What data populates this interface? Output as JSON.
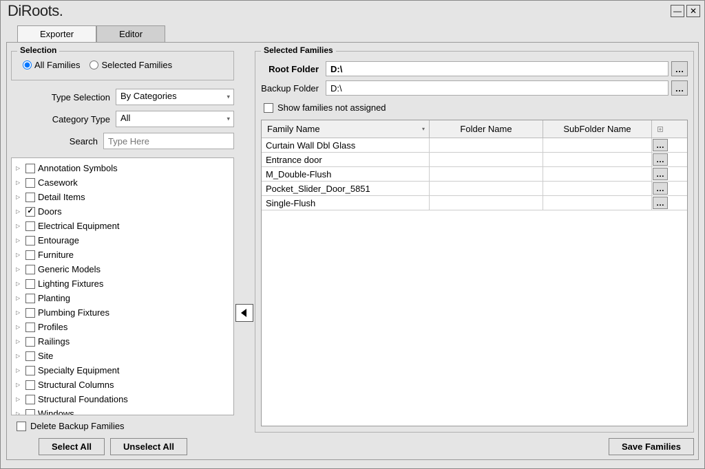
{
  "app": {
    "name": "DiRoots."
  },
  "window": {
    "minimize": "—",
    "close": "✕"
  },
  "tabs": {
    "exporter": "Exporter",
    "editor": "Editor"
  },
  "selection": {
    "title": "Selection",
    "allFamilies": "All Families",
    "selectedFamilies": "Selected Families",
    "typeSelectionLabel": "Type Selection",
    "typeSelectionValue": "By Categories",
    "categoryTypeLabel": "Category Type",
    "categoryTypeValue": "All",
    "searchLabel": "Search",
    "searchPlaceholder": "Type Here"
  },
  "tree": [
    {
      "label": "Annotation Symbols",
      "checked": false
    },
    {
      "label": "Casework",
      "checked": false
    },
    {
      "label": "Detail Items",
      "checked": false
    },
    {
      "label": "Doors",
      "checked": true
    },
    {
      "label": "Electrical Equipment",
      "checked": false
    },
    {
      "label": "Entourage",
      "checked": false
    },
    {
      "label": "Furniture",
      "checked": false
    },
    {
      "label": "Generic Models",
      "checked": false
    },
    {
      "label": "Lighting Fixtures",
      "checked": false
    },
    {
      "label": "Planting",
      "checked": false
    },
    {
      "label": "Plumbing Fixtures",
      "checked": false
    },
    {
      "label": "Profiles",
      "checked": false
    },
    {
      "label": "Railings",
      "checked": false
    },
    {
      "label": "Site",
      "checked": false
    },
    {
      "label": "Specialty Equipment",
      "checked": false
    },
    {
      "label": "Structural Columns",
      "checked": false
    },
    {
      "label": "Structural Foundations",
      "checked": false
    },
    {
      "label": "Windows",
      "checked": false
    }
  ],
  "deleteBackupLabel": "Delete Backup Families",
  "buttons": {
    "selectAll": "Select All",
    "unselectAll": "Unselect All",
    "saveFamilies": "Save Families"
  },
  "selectedFamilies": {
    "title": "Selected Families",
    "rootFolderLabel": "Root Folder",
    "rootFolderValue": "D:\\",
    "backupFolderLabel": "Backup Folder",
    "backupFolderValue": "D:\\",
    "showNotAssigned": "Show families not assigned",
    "columns": {
      "familyName": "Family Name",
      "folderName": "Folder Name",
      "subfolderName": "SubFolder Name"
    },
    "rows": [
      {
        "family": "Curtain Wall Dbl Glass",
        "folder": "",
        "subfolder": ""
      },
      {
        "family": "Entrance door",
        "folder": "",
        "subfolder": ""
      },
      {
        "family": "M_Double-Flush",
        "folder": "",
        "subfolder": ""
      },
      {
        "family": "Pocket_Slider_Door_5851",
        "folder": "",
        "subfolder": ""
      },
      {
        "family": "Single-Flush",
        "folder": "",
        "subfolder": ""
      }
    ]
  }
}
